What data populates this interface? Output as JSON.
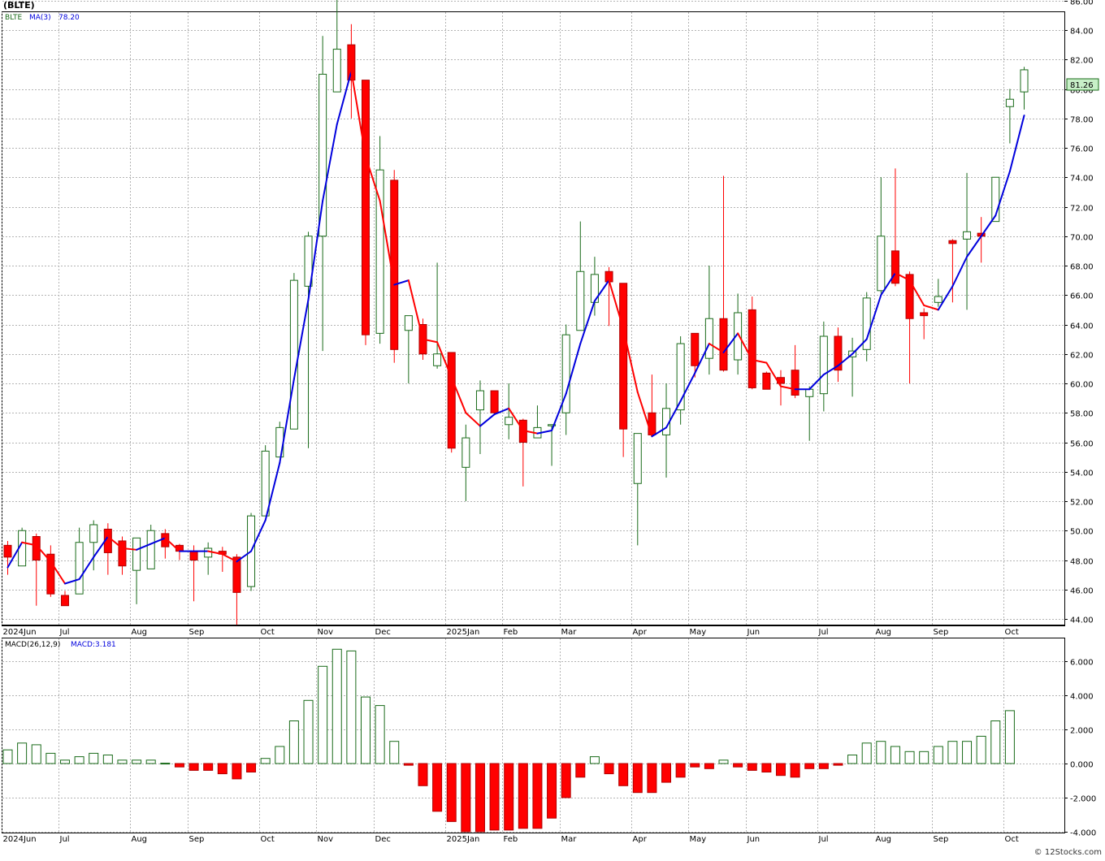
{
  "header": {
    "title": "(BLTE)"
  },
  "legend": {
    "symbol": "BLTE",
    "ma_label": "MA(3)",
    "ma_value": "78.20",
    "macd_label": "MACD(26,12,9)",
    "macd_value_label": "MACD:3.181"
  },
  "last_price_label": "81.26",
  "watermark": "© 12Stocks.com",
  "colors": {
    "up": "#1a6b1a",
    "down": "#ff0000",
    "ma_up": "#0000dd",
    "ma_down": "#ff0000",
    "grid": "#b4b4b4",
    "price_label_bg": "#c8f0c8"
  },
  "chart_data": [
    {
      "type": "candlestick",
      "price_axis": {
        "min": 44,
        "max": 86,
        "ticks": [
          "44.00",
          "46.00",
          "48.00",
          "50.00",
          "52.00",
          "54.00",
          "56.00",
          "58.00",
          "60.00",
          "62.00",
          "64.00",
          "66.00",
          "68.00",
          "70.00",
          "72.00",
          "74.00",
          "76.00",
          "78.00",
          "80.00",
          "82.00",
          "84.00",
          "86.00"
        ]
      },
      "months": [
        {
          "label": "2024Jun",
          "week": 0
        },
        {
          "label": "Jul",
          "week": 4
        },
        {
          "label": "Aug",
          "week": 9
        },
        {
          "label": "Sep",
          "week": 13
        },
        {
          "label": "Oct",
          "week": 18
        },
        {
          "label": "Nov",
          "week": 22
        },
        {
          "label": "Dec",
          "week": 26
        },
        {
          "label": "2025Jan",
          "week": 31
        },
        {
          "label": "Feb",
          "week": 35
        },
        {
          "label": "Mar",
          "week": 39
        },
        {
          "label": "Apr",
          "week": 44
        },
        {
          "label": "May",
          "week": 48
        },
        {
          "label": "Jun",
          "week": 52
        },
        {
          "label": "Jul",
          "week": 57
        },
        {
          "label": "Aug",
          "week": 61
        },
        {
          "label": "Sep",
          "week": 65
        },
        {
          "label": "Oct",
          "week": 70
        }
      ],
      "candles": [
        {
          "o": 49.0,
          "h": 49.3,
          "l": 47.0,
          "c": 48.2
        },
        {
          "o": 47.6,
          "h": 50.2,
          "l": 47.6,
          "c": 50.0
        },
        {
          "o": 49.6,
          "h": 49.8,
          "l": 44.9,
          "c": 48.0
        },
        {
          "o": 48.4,
          "h": 49.0,
          "l": 45.5,
          "c": 45.7
        },
        {
          "o": 45.6,
          "h": 45.9,
          "l": 44.9,
          "c": 44.9
        },
        {
          "o": 45.7,
          "h": 50.2,
          "l": 45.7,
          "c": 49.2
        },
        {
          "o": 49.2,
          "h": 50.7,
          "l": 47.3,
          "c": 50.4
        },
        {
          "o": 50.1,
          "h": 50.5,
          "l": 47.0,
          "c": 48.5
        },
        {
          "o": 49.3,
          "h": 49.6,
          "l": 47.0,
          "c": 47.6
        },
        {
          "o": 47.3,
          "h": 49.5,
          "l": 45.0,
          "c": 49.5
        },
        {
          "o": 47.4,
          "h": 50.4,
          "l": 47.4,
          "c": 50.0
        },
        {
          "o": 49.8,
          "h": 50.1,
          "l": 48.1,
          "c": 48.9
        },
        {
          "o": 49.0,
          "h": 49.1,
          "l": 48.0,
          "c": 48.6
        },
        {
          "o": 48.6,
          "h": 49.0,
          "l": 45.2,
          "c": 48.0
        },
        {
          "o": 48.2,
          "h": 49.2,
          "l": 47.0,
          "c": 48.8
        },
        {
          "o": 48.6,
          "h": 48.9,
          "l": 47.2,
          "c": 48.4
        },
        {
          "o": 48.2,
          "h": 48.4,
          "l": 43.6,
          "c": 45.8
        },
        {
          "o": 46.2,
          "h": 51.2,
          "l": 45.9,
          "c": 51.0
        },
        {
          "o": 51.0,
          "h": 55.8,
          "l": 51.0,
          "c": 55.4
        },
        {
          "o": 55.0,
          "h": 57.4,
          "l": 55.0,
          "c": 57.0
        },
        {
          "o": 56.9,
          "h": 67.5,
          "l": 56.9,
          "c": 67.0
        },
        {
          "o": 66.6,
          "h": 70.3,
          "l": 55.6,
          "c": 70.0
        },
        {
          "o": 70.0,
          "h": 83.6,
          "l": 62.2,
          "c": 81.0
        },
        {
          "o": 79.8,
          "h": 86.6,
          "l": 79.8,
          "c": 82.7
        },
        {
          "o": 83.0,
          "h": 84.4,
          "l": 78.0,
          "c": 80.6
        },
        {
          "o": 80.6,
          "h": 80.6,
          "l": 62.6,
          "c": 63.3
        },
        {
          "o": 63.4,
          "h": 76.8,
          "l": 62.7,
          "c": 74.5
        },
        {
          "o": 73.8,
          "h": 74.5,
          "l": 61.4,
          "c": 62.3
        },
        {
          "o": 63.6,
          "h": 64.5,
          "l": 60.0,
          "c": 64.6
        },
        {
          "o": 64.0,
          "h": 64.4,
          "l": 61.6,
          "c": 62.0
        },
        {
          "o": 61.2,
          "h": 68.2,
          "l": 61.0,
          "c": 62.0
        },
        {
          "o": 62.1,
          "h": 62.1,
          "l": 55.3,
          "c": 55.6
        },
        {
          "o": 54.3,
          "h": 57.2,
          "l": 52.0,
          "c": 56.3
        },
        {
          "o": 58.2,
          "h": 60.2,
          "l": 55.2,
          "c": 59.5
        },
        {
          "o": 59.5,
          "h": 59.5,
          "l": 57.9,
          "c": 58.0
        },
        {
          "o": 57.2,
          "h": 60.0,
          "l": 56.2,
          "c": 57.7
        },
        {
          "o": 57.5,
          "h": 57.6,
          "l": 53.0,
          "c": 56.0
        },
        {
          "o": 56.3,
          "h": 58.5,
          "l": 56.3,
          "c": 57.0
        },
        {
          "o": 57.2,
          "h": 57.2,
          "l": 54.4,
          "c": 57.2
        },
        {
          "o": 58.0,
          "h": 64.0,
          "l": 56.5,
          "c": 63.3
        },
        {
          "o": 63.6,
          "h": 71.0,
          "l": 63.6,
          "c": 67.6
        },
        {
          "o": 65.5,
          "h": 68.6,
          "l": 64.6,
          "c": 67.4
        },
        {
          "o": 67.6,
          "h": 67.9,
          "l": 63.9,
          "c": 66.9
        },
        {
          "o": 66.8,
          "h": 66.8,
          "l": 55.0,
          "c": 56.9
        },
        {
          "o": 53.2,
          "h": 56.6,
          "l": 49.0,
          "c": 56.6
        },
        {
          "o": 58.0,
          "h": 60.6,
          "l": 56.5,
          "c": 56.5
        },
        {
          "o": 56.5,
          "h": 60.0,
          "l": 53.6,
          "c": 58.3
        },
        {
          "o": 58.2,
          "h": 63.2,
          "l": 57.2,
          "c": 62.7
        },
        {
          "o": 63.4,
          "h": 63.4,
          "l": 60.4,
          "c": 61.2
        },
        {
          "o": 61.7,
          "h": 68.0,
          "l": 60.6,
          "c": 64.4
        },
        {
          "o": 64.4,
          "h": 74.1,
          "l": 60.8,
          "c": 60.9
        },
        {
          "o": 61.6,
          "h": 66.1,
          "l": 60.6,
          "c": 64.8
        },
        {
          "o": 65.0,
          "h": 65.9,
          "l": 59.6,
          "c": 59.7
        },
        {
          "o": 60.7,
          "h": 60.8,
          "l": 59.6,
          "c": 59.6
        },
        {
          "o": 60.4,
          "h": 60.9,
          "l": 58.5,
          "c": 60.0
        },
        {
          "o": 60.9,
          "h": 62.6,
          "l": 59.0,
          "c": 59.2
        },
        {
          "o": 59.1,
          "h": 59.8,
          "l": 56.1,
          "c": 59.6
        },
        {
          "o": 59.3,
          "h": 64.2,
          "l": 58.1,
          "c": 63.2
        },
        {
          "o": 63.2,
          "h": 63.8,
          "l": 60.1,
          "c": 60.9
        },
        {
          "o": 61.8,
          "h": 63.1,
          "l": 59.1,
          "c": 62.2
        },
        {
          "o": 62.3,
          "h": 66.2,
          "l": 61.5,
          "c": 65.8
        },
        {
          "o": 66.3,
          "h": 74.0,
          "l": 66.1,
          "c": 70.0
        },
        {
          "o": 69.0,
          "h": 74.6,
          "l": 66.6,
          "c": 66.8
        },
        {
          "o": 67.4,
          "h": 67.6,
          "l": 60.0,
          "c": 64.4
        },
        {
          "o": 64.8,
          "h": 65.1,
          "l": 63.0,
          "c": 64.6
        },
        {
          "o": 65.5,
          "h": 67.1,
          "l": 65.2,
          "c": 65.9
        },
        {
          "o": 69.7,
          "h": 69.8,
          "l": 65.5,
          "c": 69.5
        },
        {
          "o": 69.8,
          "h": 74.3,
          "l": 65.0,
          "c": 70.3
        },
        {
          "o": 70.2,
          "h": 71.3,
          "l": 68.2,
          "c": 70.0
        },
        {
          "o": 71.0,
          "h": 74.0,
          "l": 71.0,
          "c": 74.0
        },
        {
          "o": 78.8,
          "h": 80.0,
          "l": 76.3,
          "c": 79.3
        },
        {
          "o": 79.8,
          "h": 81.5,
          "l": 78.6,
          "c": 81.3
        }
      ],
      "ma3": [
        47.5,
        49.2,
        49.0,
        47.9,
        46.4,
        46.7,
        48.2,
        49.6,
        48.8,
        48.7,
        49.1,
        49.5,
        48.6,
        48.6,
        48.6,
        48.4,
        47.9,
        48.6,
        50.7,
        54.6,
        60.3,
        65.7,
        72.4,
        77.6,
        81.2,
        75.4,
        72.4,
        66.7,
        67.0,
        63.0,
        62.8,
        60.4,
        58.0,
        57.1,
        57.9,
        58.3,
        56.8,
        56.6,
        56.8,
        59.3,
        62.7,
        65.6,
        67.0,
        63.7,
        59.4,
        56.4,
        57.0,
        58.8,
        60.7,
        62.7,
        62.1,
        63.4,
        61.6,
        61.4,
        59.8,
        59.6,
        59.6,
        60.6,
        61.2,
        62.0,
        63.0,
        66.0,
        67.5,
        67.0,
        65.3,
        65.0,
        66.6,
        68.6,
        70.0,
        71.4,
        74.4,
        78.2
      ],
      "macd_axis": {
        "min": -4,
        "max": 7,
        "ticks": [
          "-4.000",
          "-2.000",
          "0.000",
          "2.000",
          "4.000",
          "6.000"
        ]
      },
      "macd": [
        0.8,
        1.2,
        1.1,
        0.6,
        0.2,
        0.4,
        0.6,
        0.5,
        0.2,
        0.2,
        0.2,
        0.02,
        -0.2,
        -0.4,
        -0.4,
        -0.6,
        -0.9,
        -0.5,
        0.3,
        1.0,
        2.5,
        3.7,
        5.7,
        6.7,
        6.6,
        3.9,
        3.4,
        1.3,
        -0.1,
        -1.3,
        -2.8,
        -3.4,
        -4.0,
        -4.0,
        -3.9,
        -3.9,
        -3.8,
        -3.8,
        -3.2,
        -2.0,
        -0.8,
        0.4,
        -0.6,
        -1.3,
        -1.7,
        -1.7,
        -1.1,
        -0.8,
        -0.2,
        -0.3,
        0.2,
        -0.2,
        -0.4,
        -0.5,
        -0.7,
        -0.8,
        -0.3,
        -0.3,
        -0.1,
        0.5,
        1.2,
        1.3,
        1.0,
        0.7,
        0.7,
        1.0,
        1.3,
        1.3,
        1.6,
        2.5,
        3.1
      ]
    }
  ]
}
